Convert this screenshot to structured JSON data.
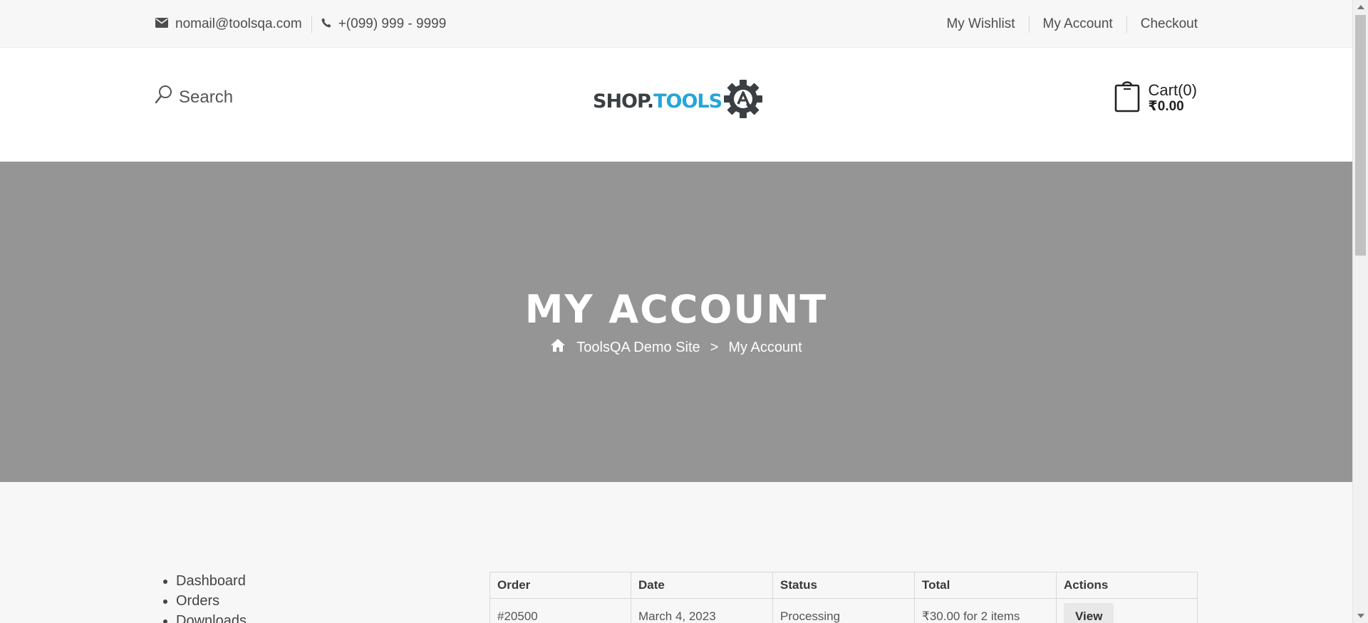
{
  "topbar": {
    "email": "nomail@toolsqa.com",
    "phone": "+(099) 999 - 9999",
    "links": [
      "My Wishlist",
      "My Account",
      "Checkout"
    ]
  },
  "header": {
    "search_label": "Search",
    "logo": {
      "part1": "SHOP.",
      "part2": "TOOLS"
    },
    "cart": {
      "title": "Cart(0)",
      "amount": "₹0.00"
    }
  },
  "banner": {
    "title": "MY ACCOUNT",
    "breadcrumb": {
      "home": "ToolsQA Demo Site",
      "separator": ">",
      "current": "My Account"
    }
  },
  "account_nav": [
    "Dashboard",
    "Orders",
    "Downloads"
  ],
  "orders_table": {
    "headers": [
      "Order",
      "Date",
      "Status",
      "Total",
      "Actions"
    ],
    "rows": [
      {
        "order": "#20500",
        "date": "March 4, 2023",
        "status": "Processing",
        "total": "₹30.00 for 2 items",
        "action": "View"
      }
    ]
  },
  "colors": {
    "banner_bg": "#959595",
    "logo_accent": "#25a6d9",
    "logo_dark": "#3a3f44"
  }
}
